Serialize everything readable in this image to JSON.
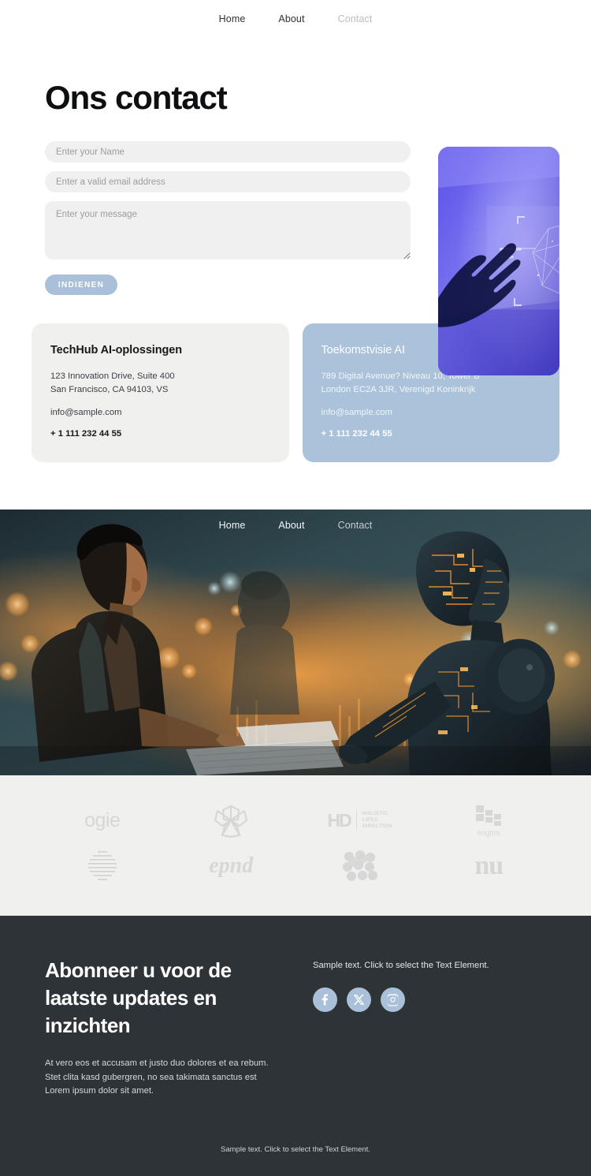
{
  "top_nav": {
    "items": [
      {
        "label": "Home",
        "state": "active"
      },
      {
        "label": "About",
        "state": "active"
      },
      {
        "label": "Contact",
        "state": "muted"
      }
    ]
  },
  "contact": {
    "title": "Ons contact",
    "form": {
      "name_placeholder": "Enter your Name",
      "name_value": "",
      "email_placeholder": "Enter a valid email address",
      "email_value": "",
      "message_placeholder": "Enter your message",
      "message_value": "",
      "submit_label": "INDIENEN",
      "submit_color": "#a9c0d8",
      "field_bg": "#f0f0f0"
    },
    "side_image": {
      "name": "hand-touching-hologram-image",
      "accent": "#4b42d8"
    }
  },
  "cards": [
    {
      "title": "TechHub AI-oplossingen",
      "address_line1": "123 Innovation Drive, Suite 400",
      "address_line2": "San Francisco, CA 94103, VS",
      "email": "info@sample.com",
      "phone": "+ 1 111 232 44 55",
      "bg": "#f0f0ef",
      "variant": "grey"
    },
    {
      "title": "Toekomstvisie AI",
      "address_line1": "789 Digital Avenue? Niveau 10, Tower B",
      "address_line2": "London EC2A 3JR, Verenigd Koninkrijk",
      "email": "info@sample.com",
      "phone": "+ 1 111 232 44 55",
      "bg": "#aac2da",
      "variant": "blue"
    }
  ],
  "hero": {
    "image_name": "woman-and-robot-at-keyboard-image",
    "nav": [
      {
        "label": "Home",
        "state": "active"
      },
      {
        "label": "About",
        "state": "active"
      },
      {
        "label": "Contact",
        "state": "muted"
      }
    ]
  },
  "logos": {
    "bg": "#f0f0ef",
    "row1": [
      {
        "name": "ogie-logo",
        "text": "ogie",
        "kind": "word"
      },
      {
        "name": "flower-star-logo",
        "text": "",
        "kind": "mark"
      },
      {
        "name": "hd-holistic-lifes-direction-logo",
        "text": "HD",
        "sub1": "HOLISTIC",
        "sub2": "LIFES",
        "sub3": "DIRECTION",
        "kind": "hd"
      },
      {
        "name": "brighto-logo",
        "text": "brighto",
        "kind": "brighto"
      }
    ],
    "row2": [
      {
        "name": "striped-globe-logo",
        "text": "",
        "kind": "mark"
      },
      {
        "name": "script-wordmark-logo",
        "text": "epnd",
        "kind": "script"
      },
      {
        "name": "dot-cluster-logo",
        "text": "",
        "kind": "mark"
      },
      {
        "name": "nu-logo",
        "text": "nu",
        "kind": "nu"
      }
    ]
  },
  "footer": {
    "bg": "#2e3338",
    "heading": "Abonneer u voor de laatste updates en inzichten",
    "body_line1": "At vero eos et accusam et justo duo dolores et ea rebum.",
    "body_line2": "Stet clita kasd gubergren, no sea takimata sanctus est",
    "body_line3": "Lorem ipsum dolor sit amet.",
    "right_text": "Sample text. Click to select the Text Element.",
    "socials": [
      {
        "name": "facebook-icon",
        "label": "Facebook"
      },
      {
        "name": "x-twitter-icon",
        "label": "X"
      },
      {
        "name": "instagram-icon",
        "label": "Instagram"
      }
    ],
    "social_bg": "#a9c0d8",
    "bottom_text": "Sample text. Click to select the Text Element."
  }
}
